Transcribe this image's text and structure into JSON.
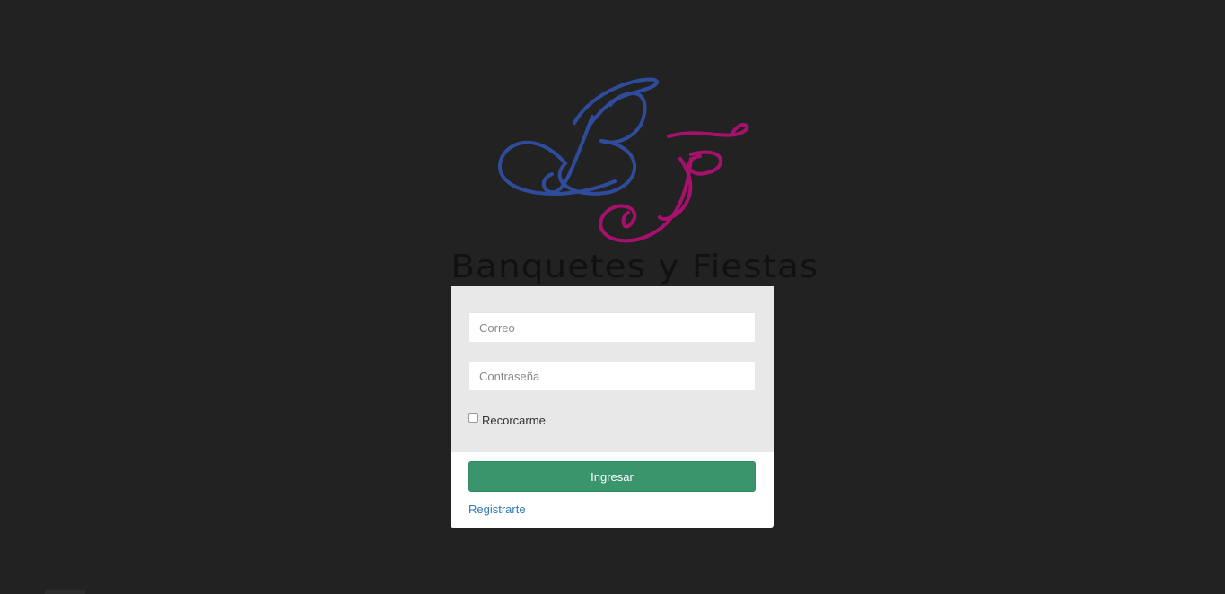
{
  "brand": {
    "monogram": "BF",
    "name": "Banquetes y Fiestas",
    "colors": {
      "b": "#2f4c9c",
      "f": "#a8106d",
      "text": "#111111"
    }
  },
  "login_form": {
    "email_placeholder": "Correo",
    "password_placeholder": "Contraseña",
    "remember_label": "Recorcarme",
    "remember_checked": false,
    "submit_label": "Ingresar",
    "register_link": "Registrarte"
  },
  "theme": {
    "background": "#222222",
    "card_body": "#e8e8e9",
    "button": "#3a946c",
    "link": "#337ab7"
  }
}
